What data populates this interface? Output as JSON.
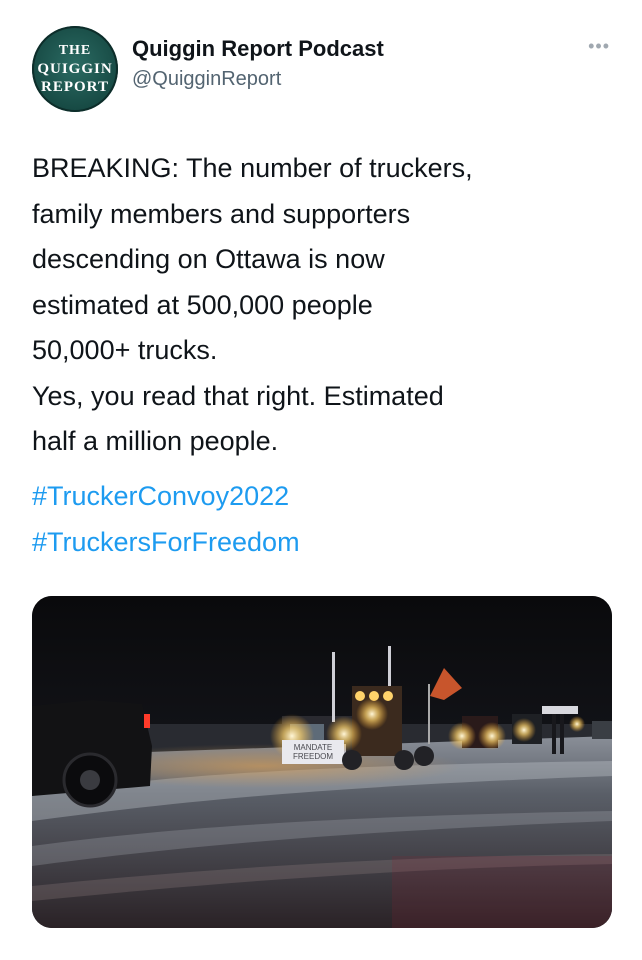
{
  "account": {
    "display_name": "Quiggin Report Podcast",
    "handle": "@QuigginReport",
    "avatar_logo_lines": [
      "THE",
      "QUIGGIN",
      "REPORT"
    ],
    "more_icon": "ellipsis-icon"
  },
  "tweet": {
    "lines": [
      "BREAKING: The number of truckers,",
      "family members and supporters",
      "descending on Ottawa is now",
      "estimated at 500,000 people",
      "50,000+ trucks.",
      "Yes, you read that right. Estimated",
      "half a million people."
    ],
    "hashtags": [
      "#TruckerConvoy2022",
      "#TruckersForFreedom"
    ]
  },
  "media": {
    "truck_sign_lines": [
      "MANDATE",
      "FREEDOM"
    ]
  },
  "colors": {
    "link": "#1d9bf0",
    "secondary_text": "#536471",
    "avatar_bg": "#1a4f48"
  }
}
